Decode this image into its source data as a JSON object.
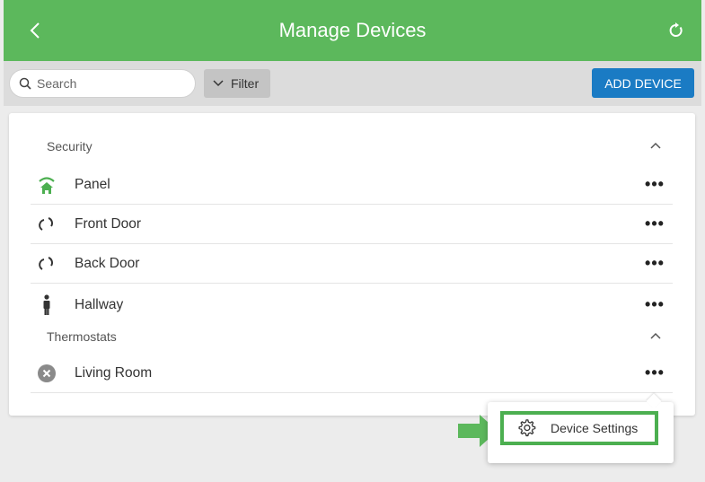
{
  "header": {
    "title": "Manage Devices",
    "back_icon": "chevron-left-icon",
    "refresh_icon": "refresh-icon",
    "bg_color": "#5cb85c"
  },
  "toolbar": {
    "search_placeholder": "Search",
    "search_value": "",
    "filter_label": "Filter",
    "add_device_label": "ADD DEVICE",
    "add_device_color": "#1a7bc4"
  },
  "sections": [
    {
      "title": "Security",
      "devices": [
        {
          "name": "Panel",
          "icon": "panel-home-icon"
        },
        {
          "name": "Front Door",
          "icon": "door-sensor-icon"
        },
        {
          "name": "Back Door",
          "icon": "door-sensor-icon"
        },
        {
          "name": "Hallway",
          "icon": "motion-sensor-person-icon"
        }
      ]
    },
    {
      "title": "Thermostats",
      "devices": [
        {
          "name": "Living Room",
          "icon": "offline-x-icon"
        }
      ]
    }
  ],
  "popup_menu": {
    "items": [
      {
        "label": "Device Settings",
        "icon": "gear-icon",
        "highlighted": true
      }
    ],
    "highlight_color": "#4caf50"
  }
}
